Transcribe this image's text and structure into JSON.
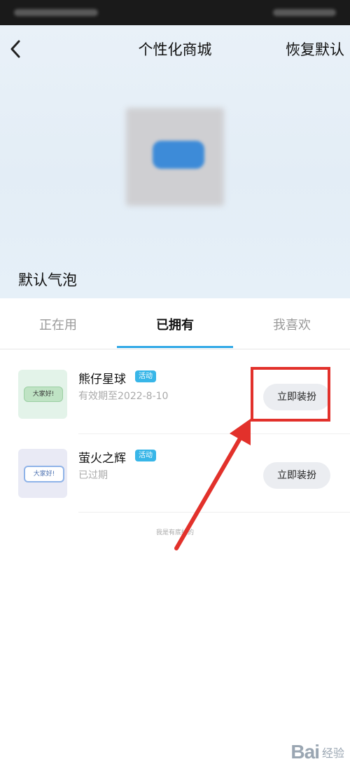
{
  "header": {
    "title": "个性化商城",
    "reset_label": "恢复默认"
  },
  "preview": {
    "bubble_name": "默认气泡"
  },
  "tabs": [
    {
      "label": "正在用"
    },
    {
      "label": "已拥有"
    },
    {
      "label": "我喜欢"
    }
  ],
  "items": [
    {
      "title": "熊仔星球",
      "badge": "活动",
      "subtitle": "有效期至2022-8-10",
      "thumb_text": "大家好!",
      "button_label": "立即装扮"
    },
    {
      "title": "萤火之辉",
      "badge": "活动",
      "subtitle": "已过期",
      "thumb_text": "大家好!",
      "button_label": "立即装扮"
    }
  ],
  "footer_note": "我是有底线的",
  "watermark": {
    "logo": "Bai",
    "label": "经验"
  },
  "colors": {
    "accent": "#2fa8e6",
    "badge": "#38b6e8",
    "highlight": "#e2312b"
  }
}
